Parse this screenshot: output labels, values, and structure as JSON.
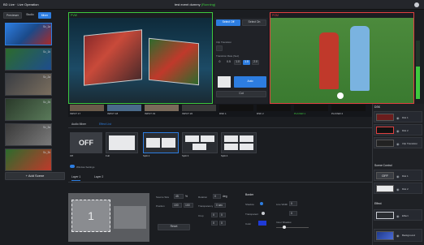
{
  "app": {
    "title": "BD Live · Live Operation",
    "nav": [
      "Tool",
      "Scene Creation",
      "Studio"
    ],
    "nav_labels": [
      "Previewer",
      "Studio",
      "Mixer"
    ],
    "event_name": "test event dummy",
    "event_status": "(Running)"
  },
  "scenes": [
    {
      "label": "Sc_1a"
    },
    {
      "label": "Sc_1b"
    },
    {
      "label": "Sc_2a"
    },
    {
      "label": "Sc_2b"
    },
    {
      "label": "Sc_3a"
    },
    {
      "label": "Sc_3b"
    }
  ],
  "add_scene_label": "+ Add Scene",
  "pvw_label": "PVW",
  "pgm_label": "PGM",
  "transition": {
    "auto_label": "Select Off",
    "cut_label": "Select On",
    "clip_transition": "Clip Transition",
    "transition_rate": "Transition Rate (Sec)",
    "rates": [
      "0",
      "0.5",
      "1.0",
      "1.5",
      "2.0"
    ],
    "cut": "Cut",
    "auto": "Auto"
  },
  "inputs": [
    "INPUT 17",
    "INPUT 18",
    "INPUT 19",
    "INPUT 20",
    "DSK 1",
    "DSK 2",
    "PLAYER 1",
    "PLAYER 2"
  ],
  "tabs": {
    "audio_mixer": "Audio Mixer",
    "effect_list": "Effect List"
  },
  "layouts": [
    {
      "label": "Off"
    },
    {
      "label": "Full"
    },
    {
      "label": "Split 2"
    },
    {
      "label": "Split 3"
    },
    {
      "label": "Split 4"
    }
  ],
  "off_big_label": "OFF",
  "window_settings": "Window Settings",
  "layer_tabs": [
    "Layer 1",
    "Layer 2"
  ],
  "canvas_number": "1",
  "props": {
    "source_size": "Source Size",
    "position": "Position",
    "crop": "Crop",
    "rotation": "Rotation",
    "transparency": "Transparency",
    "size_w": "45",
    "size_h": "%",
    "pos_x": "100",
    "pos_y": "100",
    "rot": "0",
    "rot_unit": "deg",
    "trans_val": "0 sec",
    "crop_vals": [
      "0",
      "0",
      "0",
      "0"
    ],
    "reset": "Reset"
  },
  "border": {
    "title": "Border",
    "shadow": "Shadow",
    "transparent": "Transparent",
    "color": "Color",
    "line_width": "Line Width",
    "val1": "0",
    "val2": "0",
    "inner_shadow": "Inner Shadow"
  },
  "right_panel": {
    "dsk_header": "DSK",
    "dsk_items": [
      "Dsk 1",
      "Dsk 2",
      "Clip Transition"
    ],
    "scene_control_header": "Scene Control",
    "scene_items": [
      "Dsk 1",
      "Dsk 2"
    ],
    "effect_header": "Effect",
    "effect_items": [
      "Effect",
      "Background"
    ],
    "off_label": "OFF"
  },
  "colors": {
    "accent": "#2d7de0",
    "pvw_green": "#3ec93e",
    "pgm_red": "#e04040",
    "bg": "#1b1d21"
  }
}
